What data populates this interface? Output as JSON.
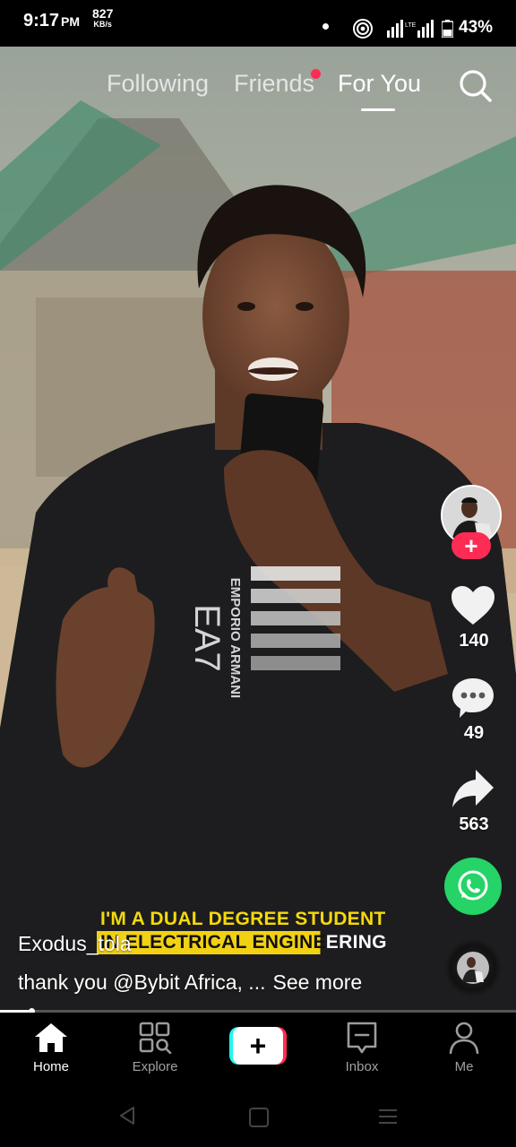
{
  "status_bar": {
    "time": "9:17",
    "ampm": "PM",
    "net_speed": "827",
    "net_unit": "KB/s",
    "battery": "43%",
    "network_label": "LTE"
  },
  "top_tabs": {
    "following": "Following",
    "friends": "Friends",
    "for_you": "For You"
  },
  "video": {
    "caption_line1": "I'M A DUAL DEGREE STUDENT",
    "caption_line2_highlight": "IN ELECTRICAL ENGINE",
    "caption_line2_rest": "ERING",
    "shirt_text": "EMPORIO ARMANI",
    "shirt_logo": "EA7",
    "progress": 0.06
  },
  "post": {
    "username": "Exodus_tola",
    "description": "thank you  @Bybit Africa, ...",
    "see_more": "See more"
  },
  "actions": {
    "likes": "140",
    "comments": "49",
    "shares": "563"
  },
  "bottom_nav": {
    "home": "Home",
    "explore": "Explore",
    "inbox": "Inbox",
    "me": "Me",
    "create": "+"
  },
  "colors": {
    "accent_red": "#fe2c55",
    "accent_cyan": "#25f4ee",
    "whatsapp": "#25d366",
    "caption_yellow": "#f1d112"
  }
}
